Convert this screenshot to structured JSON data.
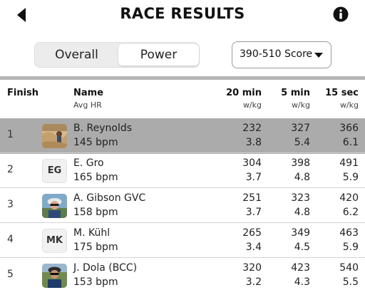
{
  "header": {
    "title": "RACE RESULTS"
  },
  "tabs": [
    {
      "label": "Overall",
      "selected": false
    },
    {
      "label": "Power",
      "selected": true
    }
  ],
  "filter": {
    "selected": "390-510 Score"
  },
  "columns": {
    "finish": "Finish",
    "name": "Name",
    "name_sub": "Avg HR",
    "c20": "20 min",
    "c5": "5 min",
    "c15": "15 sec",
    "unit": "w/kg"
  },
  "rows": [
    {
      "pos": "1",
      "name": "B. Reynolds",
      "hr": "145 bpm",
      "avatar": "photo",
      "p20": "232",
      "w20": "3.8",
      "p5": "327",
      "w5": "5.4",
      "p15": "366",
      "w15": "6.1",
      "highlight": true
    },
    {
      "pos": "2",
      "name": "E. Gro",
      "hr": "165 bpm",
      "avatar": "EG",
      "p20": "304",
      "w20": "3.7",
      "p5": "398",
      "w5": "4.8",
      "p15": "491",
      "w15": "5.9"
    },
    {
      "pos": "3",
      "name": "A. Gibson GVC",
      "hr": "158 bpm",
      "avatar": "photo",
      "p20": "251",
      "w20": "3.7",
      "p5": "323",
      "w5": "4.8",
      "p15": "420",
      "w15": "6.2"
    },
    {
      "pos": "4",
      "name": "M. Kühl",
      "hr": "175 bpm",
      "avatar": "MK",
      "p20": "265",
      "w20": "3.4",
      "p5": "349",
      "w5": "4.5",
      "p15": "463",
      "w15": "5.9"
    },
    {
      "pos": "5",
      "name": "J. Dola (BCC)",
      "hr": "153 bpm",
      "avatar": "photo",
      "p20": "320",
      "w20": "3.2",
      "p5": "423",
      "w5": "4.3",
      "p15": "540",
      "w15": "5.5"
    }
  ],
  "colors": {
    "highlight_row": "#ababab",
    "segment_bg": "#ececec"
  }
}
